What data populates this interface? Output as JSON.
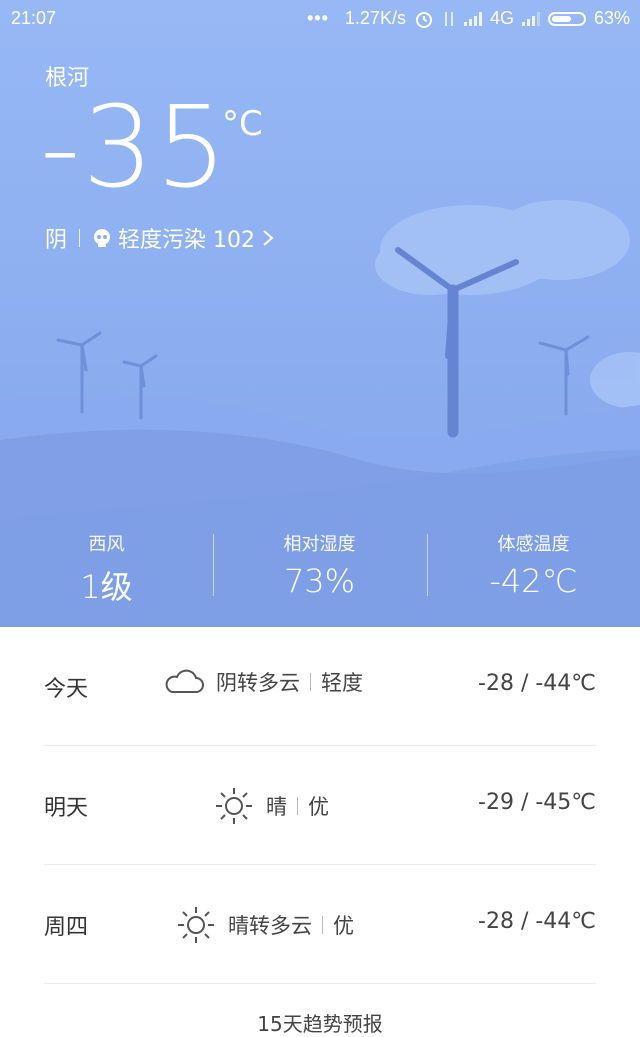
{
  "status_bar": {
    "time": "21:07",
    "dots": "•••",
    "net_speed": "1.27K/s",
    "network_type": "4G",
    "battery": "63%",
    "battery_level_percent": 63,
    "icons": [
      "alarm-icon",
      "data-arrows-icon",
      "signal-icon",
      "signal-icon",
      "battery-icon"
    ]
  },
  "weather": {
    "city": "根河",
    "temperature": "-35",
    "unit": "°C",
    "condition": "阴",
    "aqi_text": "轻度污染 102"
  },
  "stats": [
    {
      "label": "西风",
      "value": "1级"
    },
    {
      "label": "相对湿度",
      "value": "73%"
    },
    {
      "label": "体感温度",
      "value": "-42℃"
    }
  ],
  "forecast": [
    {
      "day": "今天",
      "icon": "cloud-icon",
      "desc": "阴转多云",
      "air": "轻度",
      "range": "-28 / -44℃"
    },
    {
      "day": "明天",
      "icon": "sun-icon",
      "desc": "晴",
      "air": "优",
      "range": "-29 / -45℃"
    },
    {
      "day": "周四",
      "icon": "sun-icon",
      "desc": "晴转多云",
      "air": "优",
      "range": "-28 / -44℃"
    }
  ],
  "more_label": "15天趋势预报",
  "colors": {
    "sky_top": "#97b8f5",
    "sky_bottom": "#82a5ec",
    "hill": "#7d9de3"
  }
}
